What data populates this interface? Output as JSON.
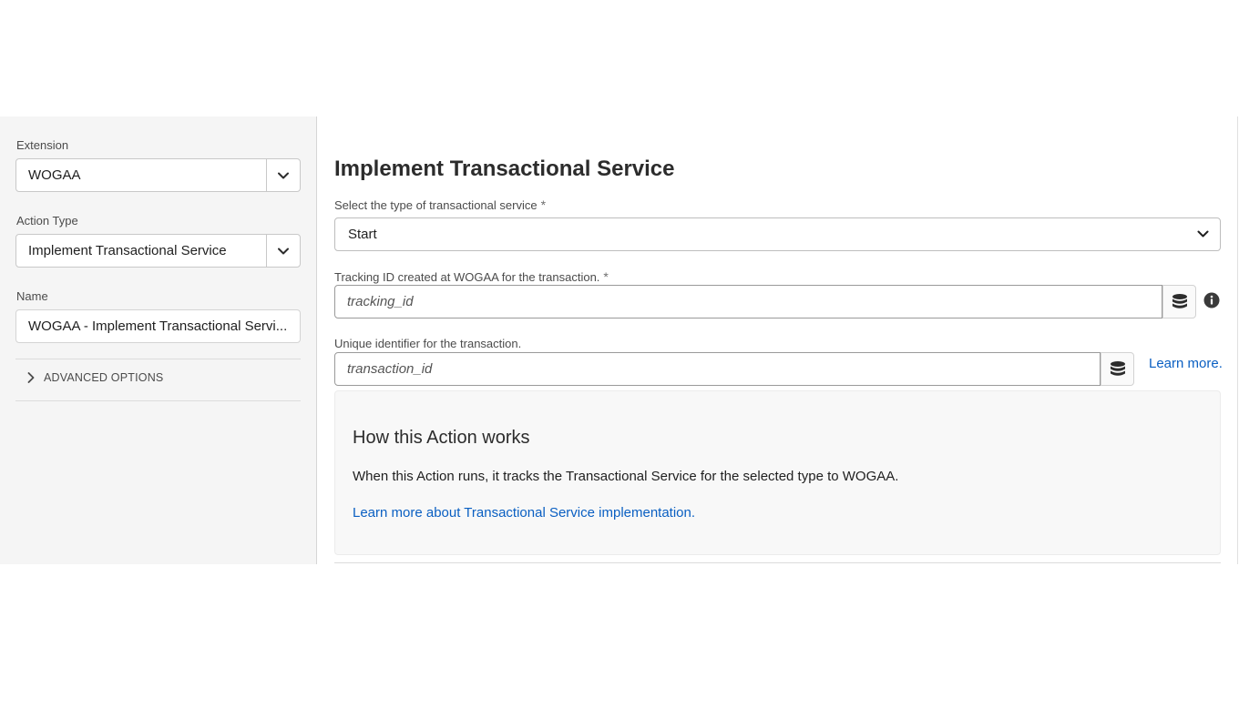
{
  "sidebar": {
    "extension": {
      "label": "Extension",
      "value": "WOGAA"
    },
    "action_type": {
      "label": "Action Type",
      "value": "Implement Transactional Service"
    },
    "name": {
      "label": "Name",
      "value": "WOGAA - Implement Transactional Servi..."
    },
    "advanced_options": "ADVANCED OPTIONS"
  },
  "main": {
    "title": "Implement Transactional Service",
    "service_type": {
      "label": "Select the type of transactional service",
      "required_mark": "*",
      "value": "Start"
    },
    "tracking_id": {
      "label": "Tracking ID created at WOGAA for the transaction.",
      "required_mark": "*",
      "value": "tracking_id"
    },
    "unique_id": {
      "label": "Unique identifier for the transaction.",
      "value": "transaction_id"
    },
    "learn_more": "Learn more.",
    "help": {
      "title": "How this Action works",
      "description": "When this Action runs, it tracks the Transactional Service for the selected type to WOGAA.",
      "link": "Learn more about Transactional Service implementation."
    }
  },
  "colors": {
    "sidebar_bg": "#f5f5f5",
    "link": "#0a5fc2",
    "help_bg": "#f8f8f8"
  },
  "icons": [
    "chevron-down-icon",
    "chevron-right-icon",
    "database-icon",
    "info-icon"
  ]
}
